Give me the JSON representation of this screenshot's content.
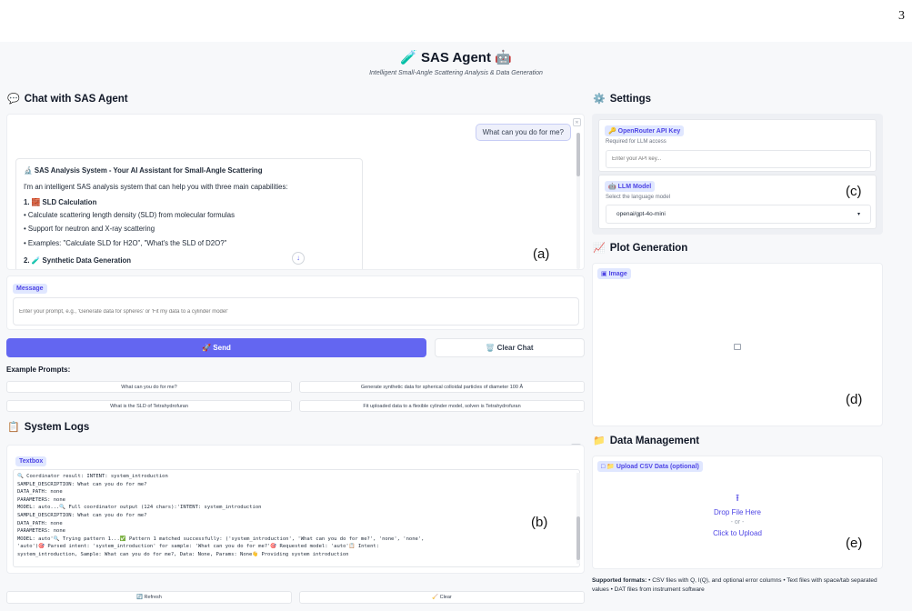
{
  "page_number": "3",
  "header": {
    "title": "🧪 SAS Agent 🤖",
    "subtitle": "Intelligent Small-Angle Scattering Analysis & Data Generation"
  },
  "chat": {
    "heading": "Chat with SAS Agent",
    "heading_icon": "💬",
    "user_message": "What can you do for me?",
    "bot": {
      "title": "🔬 SAS Analysis System - Your AI Assistant for Small-Angle Scattering",
      "intro": "I'm an intelligent SAS analysis system that can help you with three main capabilities:",
      "section1_title": "1. 🧱 SLD Calculation",
      "bullets": [
        "Calculate scattering length density (SLD) from molecular formulas",
        "Support for neutron and X-ray scattering",
        "Examples: \"Calculate SLD for H2O\", \"What's the SLD of D2O?\""
      ],
      "section2_title": "2. 🧪 Synthetic Data Generation"
    },
    "panel_label": "(a)"
  },
  "message": {
    "label": "Message",
    "placeholder": "Enter your prompt, e.g., 'Generate data for spheres' or 'Fit my data to a cylinder model'"
  },
  "actions": {
    "send": "🚀 Send",
    "clear_chat": "🗑️ Clear Chat"
  },
  "examples": {
    "heading": "Example Prompts:",
    "items": [
      "What can you do for me?",
      "Generate synthetic data for spherical colloidal particles of diameter 100 Å",
      "What is the SLD of Tetrahydrofuran",
      "Fit uploaded data to a flexible cylinder model, solven is Tetrahydrofuran"
    ]
  },
  "logs": {
    "heading": "System Logs",
    "heading_icon": "📋",
    "textbox_label": "Textbox",
    "lines": [
      "🔍 Coordinator result: INTENT: system_introduction",
      "SAMPLE_DESCRIPTION: What can you do for me?",
      "DATA_PATH: none",
      "PARAMETERS: none",
      "MODEL: auto...🔍 Full coordinator output (124 chars):'INTENT: system_introduction",
      "SAMPLE_DESCRIPTION: What can you do for me?",
      "DATA_PATH: none",
      "PARAMETERS: none",
      "MODEL: auto'🔍 Trying pattern 1...✅ Pattern 1 matched successfully: ('system_introduction', 'What can you do for me?', 'none', 'none',",
      "'auto')🎯 Parsed intent: 'system_introduction' for sample: 'What can you do for me?'🎯 Requested model: 'auto'📋 Intent:",
      "system_introduction, Sample: What can you do for me?, Data: None, Params: None👋 Providing system introduction"
    ],
    "panel_label": "(b)",
    "refresh": "🔄 Refresh",
    "clear": "🧹 Clear"
  },
  "settings": {
    "heading": "Settings",
    "heading_icon": "⚙️",
    "api_label": "🔑 OpenRouter API Key",
    "api_hint": "Required for LLM access",
    "api_placeholder": "Enter your API key...",
    "llm_label": "🤖 LLM Model",
    "llm_hint": "Select the language model",
    "llm_value": "openai/gpt-4o-mini",
    "panel_label": "(c)"
  },
  "plot": {
    "heading": "Plot Generation",
    "heading_icon": "📈",
    "image_label": "Image",
    "panel_label": "(d)"
  },
  "data_mgmt": {
    "heading": "Data Management",
    "heading_icon": "📁",
    "upload_label": "📁 Upload CSV Data (optional)",
    "drop_text": "Drop File Here",
    "or_text": "- or -",
    "click_text": "Click to Upload",
    "panel_label": "(e)",
    "formats_title": "Supported formats:",
    "formats_text": " • CSV files with Q, I(Q), and optional error columns • Text files with space/tab separated values • DAT files from instrument software"
  },
  "colors": {
    "accent": "#6366f1",
    "tag_bg": "#e0e7ff",
    "page_bg": "#f7f8fa"
  }
}
